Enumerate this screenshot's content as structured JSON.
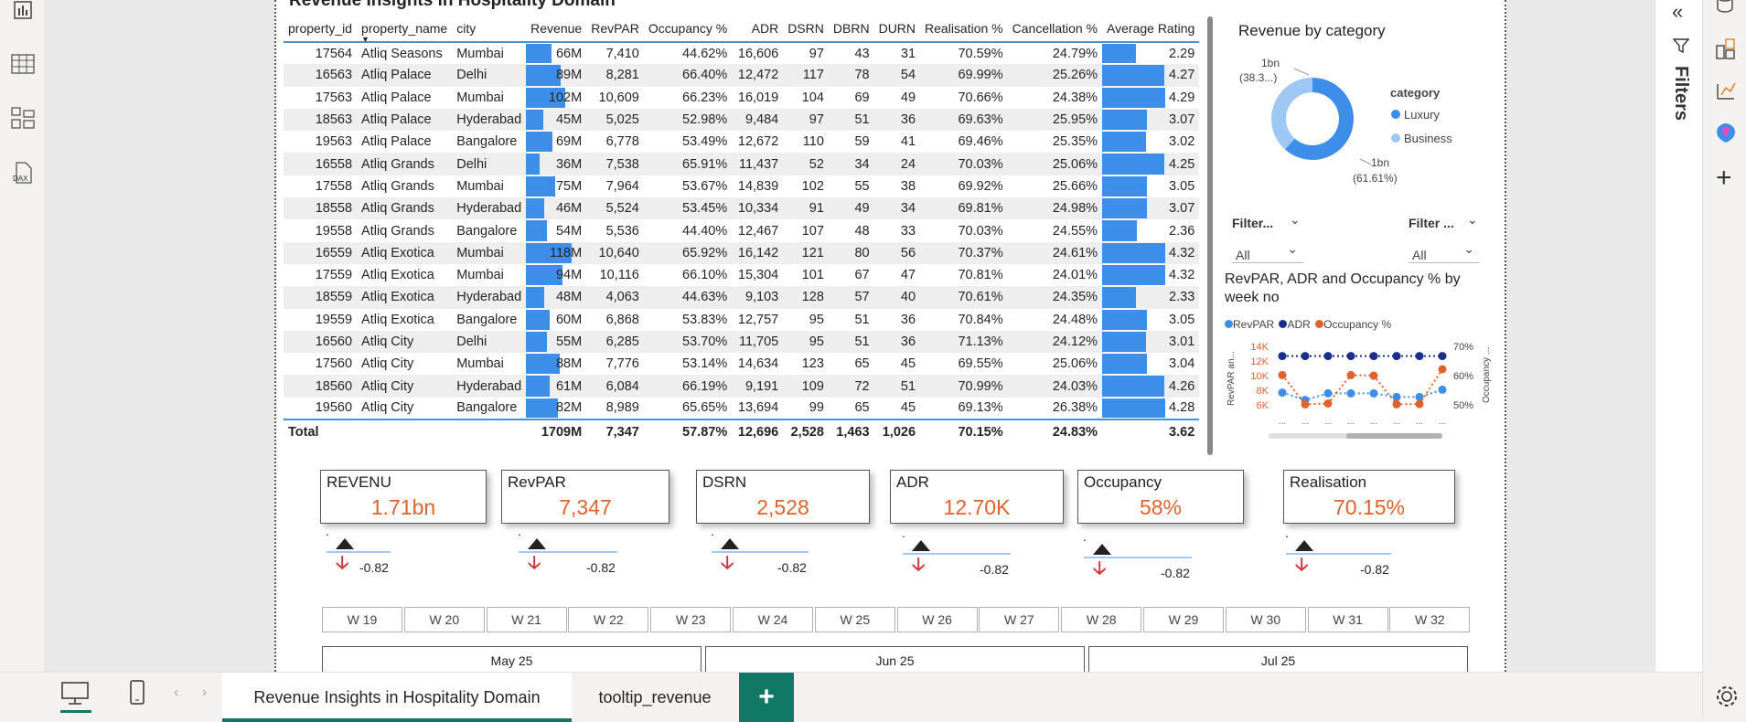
{
  "report_title": "Revenue Insights in Hospitality Domain",
  "table": {
    "headers": [
      "property_id",
      "property_name",
      "city",
      "Revenue",
      "RevPAR",
      "Occupancy %",
      "ADR",
      "DSRN",
      "DBRN",
      "DURN",
      "Realisation %",
      "Cancellation %",
      "Average Rating"
    ],
    "sort_indicator": "▼",
    "rows": [
      [
        "17564",
        "Atliq Seasons",
        "Mumbai",
        "66M",
        "7,410",
        "44.62%",
        "16,606",
        "97",
        "43",
        "31",
        "70.59%",
        "24.79%",
        "2.29"
      ],
      [
        "16563",
        "Atliq Palace",
        "Delhi",
        "89M",
        "8,281",
        "66.40%",
        "12,472",
        "117",
        "78",
        "54",
        "69.99%",
        "25.26%",
        "4.27"
      ],
      [
        "17563",
        "Atliq Palace",
        "Mumbai",
        "102M",
        "10,609",
        "66.23%",
        "16,019",
        "104",
        "69",
        "49",
        "70.66%",
        "24.38%",
        "4.29"
      ],
      [
        "18563",
        "Atliq Palace",
        "Hyderabad",
        "45M",
        "5,025",
        "52.98%",
        "9,484",
        "97",
        "51",
        "36",
        "69.63%",
        "25.95%",
        "3.07"
      ],
      [
        "19563",
        "Atliq Palace",
        "Bangalore",
        "69M",
        "6,778",
        "53.49%",
        "12,672",
        "110",
        "59",
        "41",
        "69.46%",
        "25.35%",
        "3.02"
      ],
      [
        "16558",
        "Atliq Grands",
        "Delhi",
        "36M",
        "7,538",
        "65.91%",
        "11,437",
        "52",
        "34",
        "24",
        "70.03%",
        "25.06%",
        "4.25"
      ],
      [
        "17558",
        "Atliq Grands",
        "Mumbai",
        "75M",
        "7,964",
        "53.67%",
        "14,839",
        "102",
        "55",
        "38",
        "69.92%",
        "25.66%",
        "3.05"
      ],
      [
        "18558",
        "Atliq Grands",
        "Hyderabad",
        "46M",
        "5,524",
        "53.45%",
        "10,334",
        "91",
        "49",
        "34",
        "69.81%",
        "24.98%",
        "3.07"
      ],
      [
        "19558",
        "Atliq Grands",
        "Bangalore",
        "54M",
        "5,536",
        "44.40%",
        "12,467",
        "107",
        "48",
        "33",
        "70.03%",
        "24.55%",
        "2.36"
      ],
      [
        "16559",
        "Atliq Exotica",
        "Mumbai",
        "118M",
        "10,640",
        "65.92%",
        "16,142",
        "121",
        "80",
        "56",
        "70.37%",
        "24.61%",
        "4.32"
      ],
      [
        "17559",
        "Atliq Exotica",
        "Mumbai",
        "94M",
        "10,116",
        "66.10%",
        "15,304",
        "101",
        "67",
        "47",
        "70.81%",
        "24.01%",
        "4.32"
      ],
      [
        "18559",
        "Atliq Exotica",
        "Hyderabad",
        "48M",
        "4,063",
        "44.63%",
        "9,103",
        "128",
        "57",
        "40",
        "70.61%",
        "24.35%",
        "2.33"
      ],
      [
        "19559",
        "Atliq Exotica",
        "Bangalore",
        "60M",
        "6,868",
        "53.83%",
        "12,757",
        "95",
        "51",
        "36",
        "70.84%",
        "24.48%",
        "3.05"
      ],
      [
        "16560",
        "Atliq City",
        "Delhi",
        "55M",
        "6,285",
        "53.70%",
        "11,705",
        "95",
        "51",
        "36",
        "71.13%",
        "24.12%",
        "3.01"
      ],
      [
        "17560",
        "Atliq City",
        "Mumbai",
        "88M",
        "7,776",
        "53.14%",
        "14,634",
        "123",
        "65",
        "45",
        "69.55%",
        "25.06%",
        "3.04"
      ],
      [
        "18560",
        "Atliq City",
        "Hyderabad",
        "61M",
        "6,084",
        "66.19%",
        "9,191",
        "109",
        "72",
        "51",
        "70.99%",
        "24.03%",
        "4.26"
      ],
      [
        "19560",
        "Atliq City",
        "Bangalore",
        "82M",
        "8,989",
        "65.65%",
        "13,694",
        "99",
        "65",
        "45",
        "69.13%",
        "26.38%",
        "4.28"
      ]
    ],
    "revenue_values": [
      66,
      89,
      102,
      45,
      69,
      36,
      75,
      46,
      54,
      118,
      94,
      48,
      60,
      55,
      88,
      61,
      82
    ],
    "rating_values": [
      2.29,
      4.27,
      4.29,
      3.07,
      3.02,
      4.25,
      3.05,
      3.07,
      2.36,
      4.32,
      4.32,
      2.33,
      3.05,
      3.01,
      3.04,
      4.26,
      4.28
    ],
    "total": [
      "Total",
      "",
      "",
      "1709M",
      "7,347",
      "57.87%",
      "12,696",
      "2,528",
      "1,463",
      "1,026",
      "70.15%",
      "24.83%",
      "3.62"
    ]
  },
  "donut": {
    "title": "Revenue by category",
    "legend_title": "category",
    "labels": [
      "1bn",
      "(38.3...)",
      "1bn",
      "(61.61%)"
    ],
    "chart_data": {
      "type": "pie",
      "categories": [
        "Luxury",
        "Business"
      ],
      "values": [
        61.61,
        38.39
      ]
    },
    "colors": [
      "#3d8ee8",
      "#9fc7f3"
    ]
  },
  "filters": [
    {
      "label": "Filter...",
      "value": "All"
    },
    {
      "label": "Filter ...",
      "value": "All"
    }
  ],
  "line_chart": {
    "title": "RevPAR, ADR and Occupancy % by week no",
    "legend": [
      "RevPAR",
      "ADR",
      "Occupancy %"
    ],
    "colors": [
      "#3d8ee8",
      "#1a2e8c",
      "#e0622b"
    ],
    "y_left_ticks": [
      "14K",
      "12K",
      "10K",
      "8K",
      "6K"
    ],
    "y_right_ticks": [
      "70%",
      "60%",
      "50%"
    ],
    "y_left_label": "RevPAR an...",
    "y_right_label": "Occupancy ...",
    "x_tick": "...",
    "chart_data": {
      "type": "line",
      "series": [
        {
          "name": "RevPAR",
          "values": [
            7.8,
            6.8,
            7.7,
            7.7,
            7.7,
            7.2,
            7.2,
            8.2
          ]
        },
        {
          "name": "ADR",
          "values": [
            12.8,
            12.8,
            12.8,
            12.8,
            12.8,
            12.8,
            12.8,
            12.8
          ]
        },
        {
          "name": "Occupancy %",
          "values": [
            60.5,
            50.5,
            50.8,
            60.5,
            60.3,
            50.5,
            50.6,
            62.5
          ]
        }
      ],
      "ylim_left": [
        6000,
        14000
      ],
      "ylim_right": [
        50,
        70
      ]
    }
  },
  "kpis": [
    {
      "label": "REVENU",
      "value": "1.71bn",
      "change": "-0.82"
    },
    {
      "label": "RevPAR",
      "value": "7,347",
      "change": "-0.82"
    },
    {
      "label": "DSRN",
      "value": "2,528",
      "change": "-0.82"
    },
    {
      "label": "ADR",
      "value": "12.70K",
      "change": "-0.82"
    },
    {
      "label": "Occupancy",
      "value": "58%",
      "change": "-0.82"
    },
    {
      "label": "Realisation",
      "value": "70.15%",
      "change": "-0.82"
    }
  ],
  "weeks": [
    "W 19",
    "W 20",
    "W 21",
    "W 22",
    "W 23",
    "W 24",
    "W 25",
    "W 26",
    "W 27",
    "W 28",
    "W 29",
    "W 30",
    "W 31",
    "W 32"
  ],
  "months": [
    "May 25",
    "Jun 25",
    "Jul 25"
  ],
  "filters_pane_label": "Filters",
  "tabs": [
    "Revenue Insights in Hospitality Domain",
    "tooltip_revenue"
  ],
  "add_tab": "+"
}
